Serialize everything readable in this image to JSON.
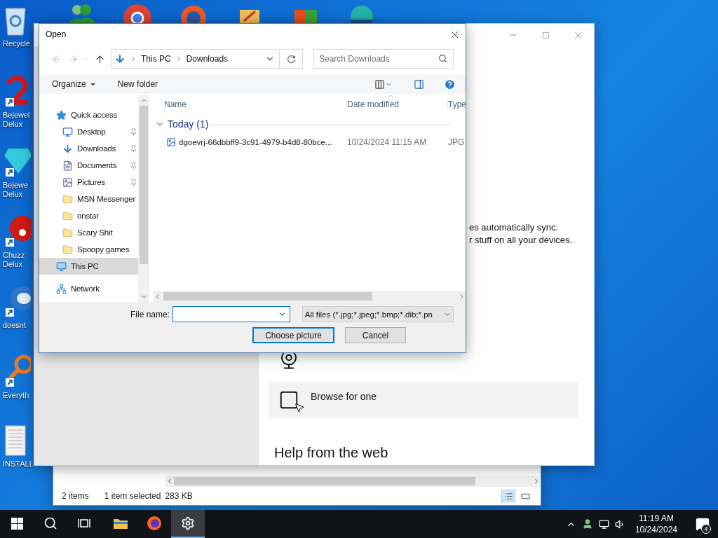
{
  "desktop_icons": [
    {
      "kind": "bin",
      "label": "Recycle"
    },
    {
      "kind": "swirl",
      "label": "Bejewel Delux"
    },
    {
      "kind": "gem",
      "label": "Bejewe Delux"
    },
    {
      "kind": "ball",
      "label": "Chuzz Delux"
    },
    {
      "kind": "globe",
      "label": "doesnt"
    },
    {
      "kind": "magnifier",
      "label": "Everyth"
    },
    {
      "kind": "document",
      "label": "INSTALL"
    }
  ],
  "settings_window": {
    "sync_lines": [
      "es automatically sync.",
      "r stuff on all your devices."
    ],
    "options": [
      {
        "kind": "camera",
        "selected": false
      },
      {
        "kind": "browse",
        "label": "Browse for one",
        "selected": true
      }
    ],
    "heading": "Help from the web"
  },
  "explorer_window": {
    "item_count": "2 items",
    "selection": "1 item selected",
    "size": "283 KB",
    "views": [
      {
        "kind": "details",
        "selected": true
      },
      {
        "kind": "tiles",
        "selected": false
      }
    ]
  },
  "dialog": {
    "title": "Open",
    "path": [
      "This PC",
      "Downloads"
    ],
    "search_placeholder": "Search Downloads",
    "organize": "Organize",
    "new_folder": "New folder",
    "nav": [
      {
        "kind": "quick",
        "label": "Quick access",
        "selected": false,
        "children": [
          {
            "kind": "desktop",
            "label": "Desktop",
            "pinned": true,
            "selected": false
          },
          {
            "kind": "downloads",
            "label": "Downloads",
            "pinned": true,
            "selected": false
          },
          {
            "kind": "documents",
            "label": "Documents",
            "pinned": true,
            "selected": false
          },
          {
            "kind": "pictures",
            "label": "Pictures",
            "pinned": true,
            "selected": false
          },
          {
            "kind": "folder",
            "label": "MSN Messenger",
            "selected": false
          },
          {
            "kind": "folder",
            "label": "onstar",
            "selected": false
          },
          {
            "kind": "folder",
            "label": "Scary Shit",
            "selected": false
          },
          {
            "kind": "folder",
            "label": "Spoopy games",
            "selected": false
          }
        ]
      },
      {
        "kind": "pc",
        "label": "This PC",
        "selected": true
      },
      {
        "kind": "network",
        "label": "Network",
        "selected": false
      }
    ],
    "columns": [
      "Name",
      "Date modified",
      "Type"
    ],
    "group": {
      "label": "Today (1)",
      "expanded": true
    },
    "files": [
      {
        "name": "dgoevrj-66dbbff9-3c91-4979-b4d8-80bce...",
        "date": "10/24/2024 11:15 AM",
        "type": "JPG"
      }
    ],
    "file_name_label": "File name:",
    "filter": "All files (*.jpg;*.jpeg;*.bmp;*.dib;*.pn",
    "buttons": [
      {
        "label": "Choose picture",
        "default": true
      },
      {
        "label": "Cancel",
        "default": false
      }
    ]
  },
  "taskbar": {
    "apps": [
      {
        "kind": "explorer",
        "active": false
      },
      {
        "kind": "firefox",
        "active": false
      },
      {
        "kind": "settings",
        "active": true
      }
    ],
    "time": "11:19 AM",
    "date": "10/24/2024",
    "notification_count": "4"
  }
}
